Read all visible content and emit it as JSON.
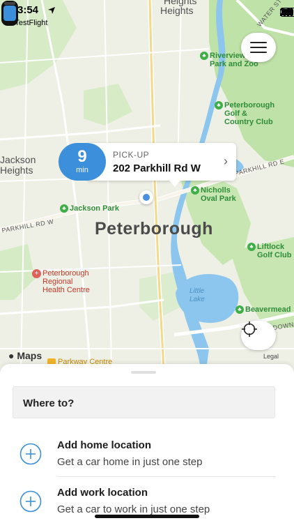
{
  "status_bar": {
    "time": "3:54",
    "back_app": "◂ TestFlight"
  },
  "map": {
    "labels": {
      "heights_top": "Heights",
      "heights_mid": "Heights",
      "jackson_heights": "Jackson\nHeights",
      "riverview": "Riverview\nPark and Zoo",
      "golf_club": "Peterborough\nGolf &\nCountry Club",
      "nicholls": "Nicholls\nOval Park",
      "jackson_park": "Jackson Park",
      "city": "Peterborough",
      "liftlock": "Liftlock\nGolf Club",
      "health": "Peterborough\nRegional\nHealth Centre",
      "little_lake": "Little\nLake",
      "beavermead": "Beavermead",
      "parkway": "Parkway Centre",
      "road_parkhill": "PARKHILL RD W",
      "road_parkhill_e": "PARKHILL RD E",
      "road_lansdowne": "LANSDOWNE ST",
      "road_water": "WATER ST"
    },
    "maps_logo": "Maps",
    "legal": "Legal"
  },
  "pickup": {
    "eta_value": "9",
    "eta_unit": "min",
    "label": "PICK-UP",
    "address": "202 Parkhill Rd W"
  },
  "sheet": {
    "search_label": "Where to?",
    "home": {
      "title": "Add home location",
      "subtitle": "Get a car home in just one step"
    },
    "work": {
      "title": "Add work location",
      "subtitle": "Get a car to work in just one step"
    }
  },
  "colors": {
    "accent": "#3b8fdb",
    "park_green": "#3fae49",
    "water_blue": "#8cc6ee",
    "health_red": "#e0615a"
  }
}
